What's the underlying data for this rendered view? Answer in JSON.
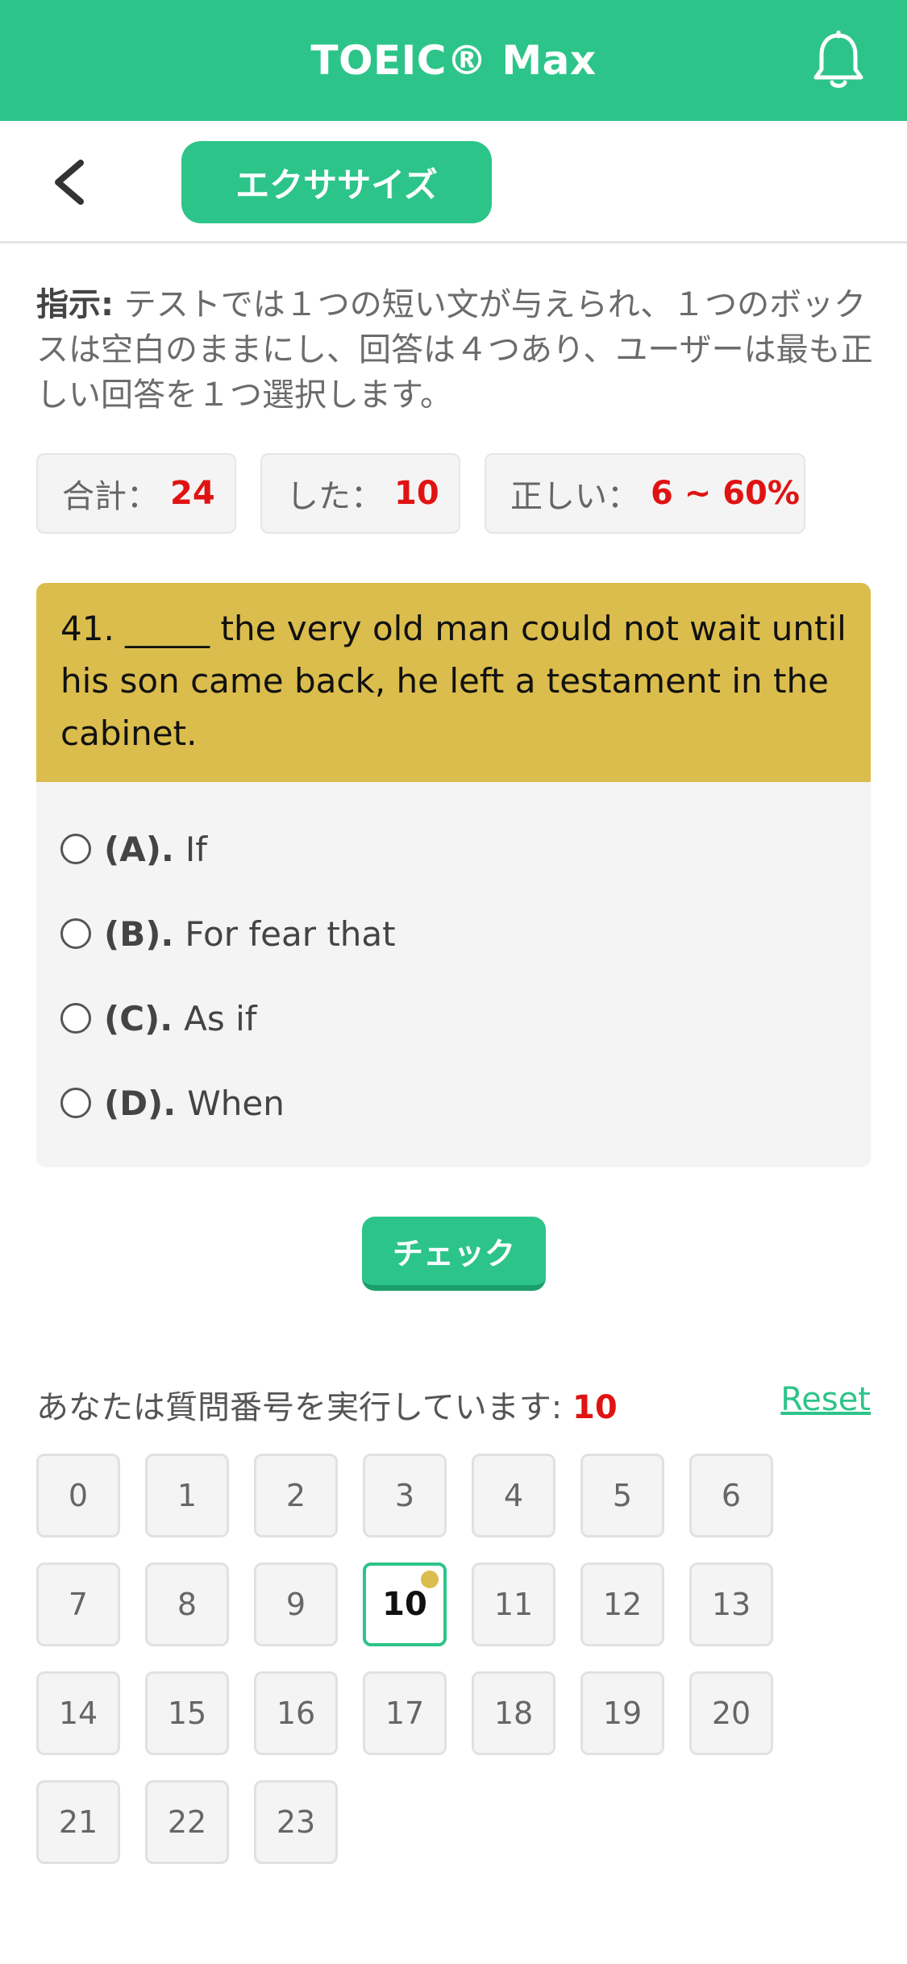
{
  "header": {
    "title": "TOEIC® Max",
    "icon": "bell-icon"
  },
  "subbar": {
    "back_icon": "chevron-left-icon",
    "tab_label": "エクササイズ"
  },
  "instructions": {
    "label": "指示:",
    "text": " テストでは１つの短い文が与えられ、１つのボックスは空白のままにし、回答は４つあり、ユーザーは最も正しい回答を１つ選択します。"
  },
  "stats": [
    {
      "label": "合計：",
      "value": "24"
    },
    {
      "label": "した：",
      "value": "10"
    },
    {
      "label": "正しい：",
      "value": "6 ~ 60%"
    }
  ],
  "question": {
    "text": "41. _____ the very old man could not wait until his son came back, he left a testament in the cabinet.",
    "options": [
      {
        "letter": "(A).",
        "text": "If"
      },
      {
        "letter": "(B).",
        "text": "For fear that"
      },
      {
        "letter": "(C).",
        "text": "As if"
      },
      {
        "letter": "(D).",
        "text": "When"
      }
    ]
  },
  "check_label": "チェック",
  "progress": {
    "label": "あなたは質問番号を実行しています:",
    "current": "10"
  },
  "reset_label": "Reset",
  "question_numbers": [
    "0",
    "1",
    "2",
    "3",
    "4",
    "5",
    "6",
    "7",
    "8",
    "9",
    "10",
    "11",
    "12",
    "13",
    "14",
    "15",
    "16",
    "17",
    "18",
    "19",
    "20",
    "21",
    "22",
    "23"
  ],
  "colors": {
    "accent": "#2dc48a",
    "question_bg": "#dbbd4d",
    "highlight": "#e01313"
  }
}
